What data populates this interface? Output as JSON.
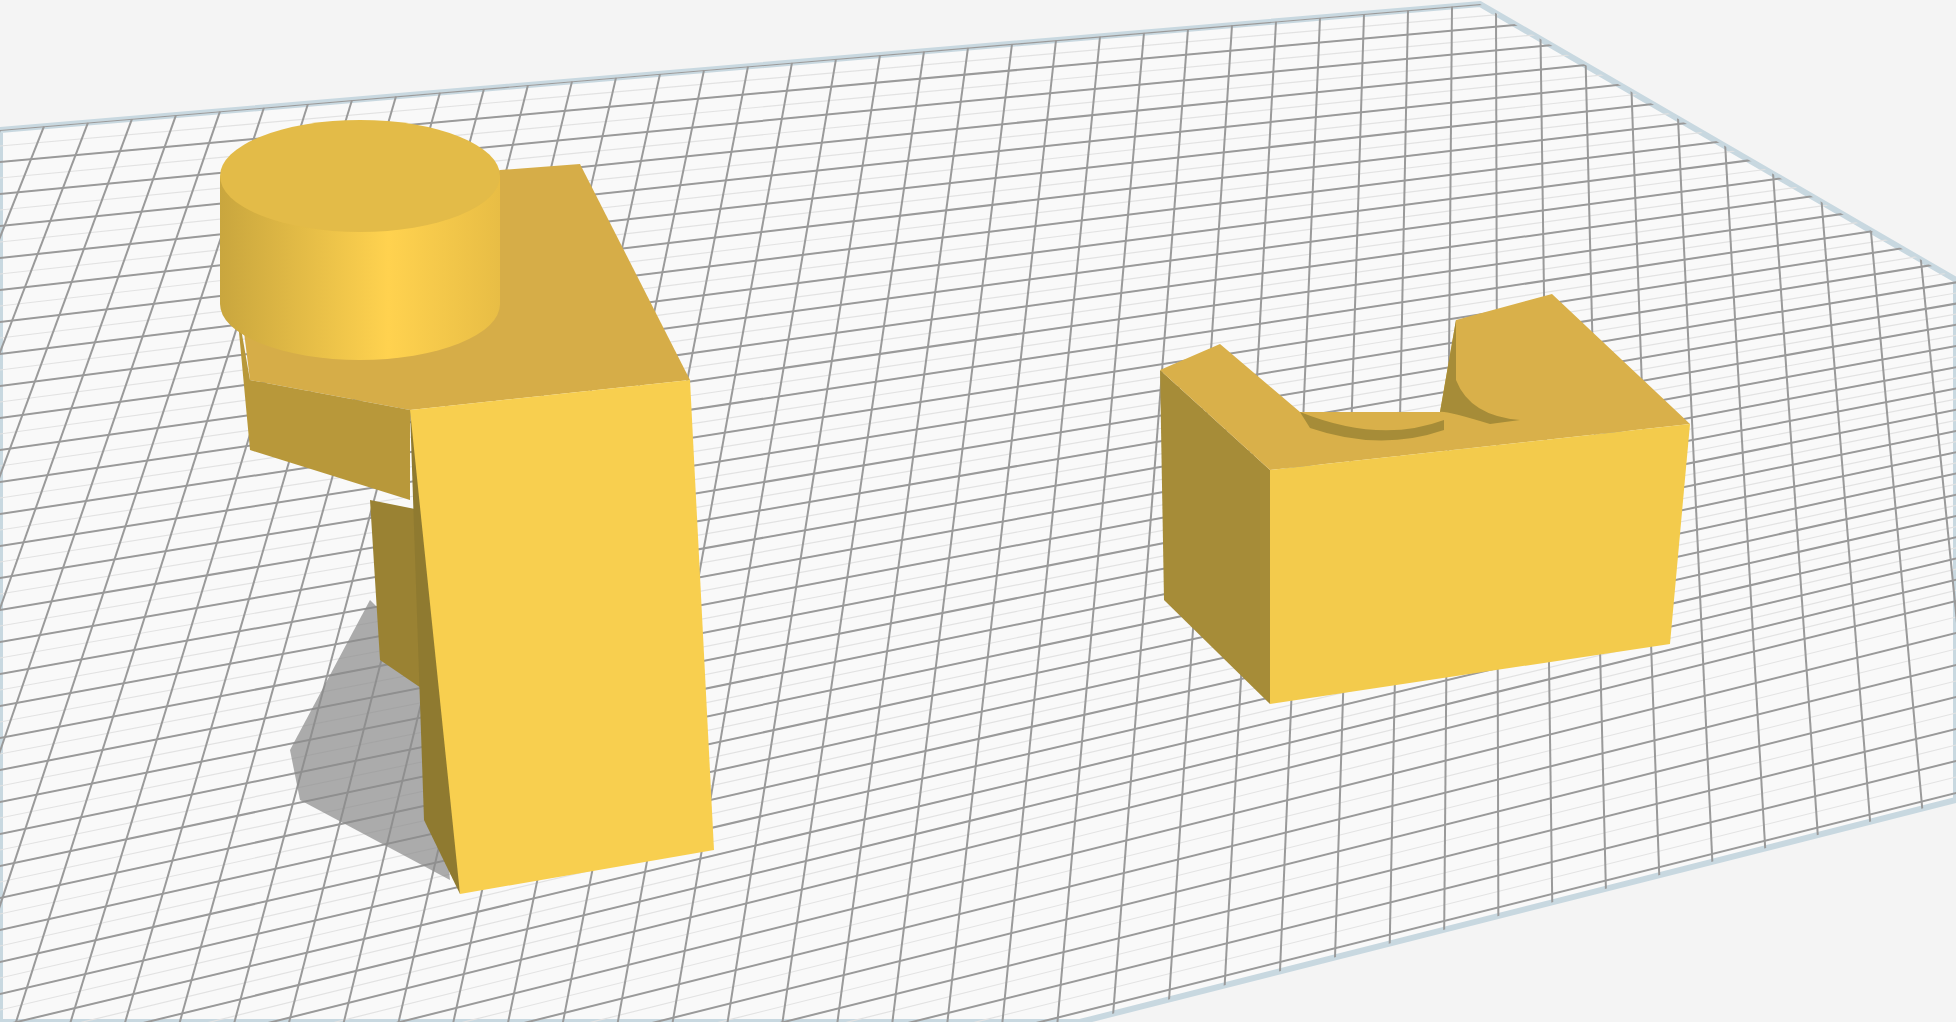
{
  "viewport": {
    "models": [
      {
        "kind": "cylinder-block"
      },
      {
        "kind": "u-block"
      }
    ]
  }
}
